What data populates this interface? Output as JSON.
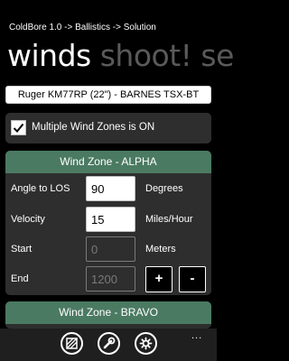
{
  "breadcrumb": "ColdBore 1.0 -> Ballistics -> Solution",
  "pivot": {
    "active": "winds",
    "next": "shoot!",
    "partial": "se"
  },
  "profile": "Ruger KM77RP (22\") - BARNES TSX-BT",
  "multi_wind": {
    "label": "Multiple Wind Zones is ON",
    "checked": true
  },
  "zones": [
    {
      "title": "Wind Zone - ALPHA",
      "angle": {
        "label": "Angle to LOS",
        "value": "90",
        "unit": "Degrees"
      },
      "velocity": {
        "label": "Velocity",
        "value": "15",
        "unit": "Miles/Hour"
      },
      "start": {
        "label": "Start",
        "value": "0",
        "unit": "Meters"
      },
      "end": {
        "label": "End",
        "value": "1200"
      },
      "plus_label": "+",
      "minus_label": "-"
    },
    {
      "title": "Wind Zone - BRAVO"
    }
  ],
  "appbar": {
    "icons": [
      "target-icon",
      "wrench-icon",
      "settings-icon"
    ],
    "more": "..."
  },
  "colors": {
    "background": "#000000",
    "panel": "#2e2e2e",
    "zone_header": "#4b7a62",
    "inactive_pivot": "#5a5a5a"
  }
}
